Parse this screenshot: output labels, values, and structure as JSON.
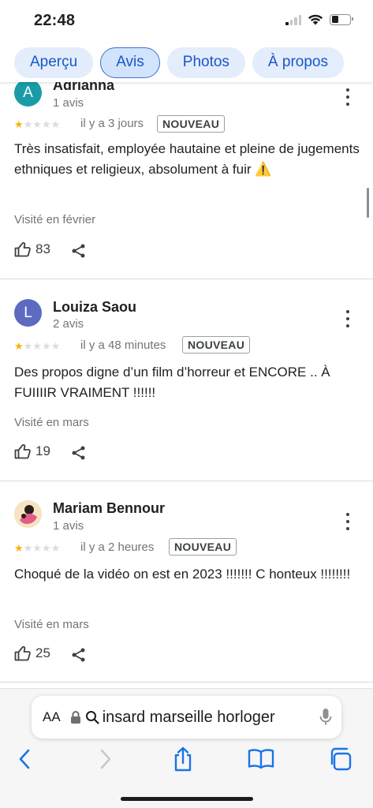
{
  "status_bar": {
    "time": "22:48"
  },
  "tabs": [
    {
      "label": "Aperçu",
      "active": false
    },
    {
      "label": "Avis",
      "active": true
    },
    {
      "label": "Photos",
      "active": false
    },
    {
      "label": "À propos",
      "active": false
    }
  ],
  "reviews": [
    {
      "avatar_letter": "A",
      "avatar_color": "#1a9ba8",
      "author": "Adrianna",
      "review_count": "1 avis",
      "rating": 1,
      "time": "il y a 3 jours",
      "badge": "NOUVEAU",
      "text": "Très insatisfait, employée hautaine et pleine de jugements ethniques et religieux, absolument à fuir ⚠️",
      "visited": "Visité en février",
      "likes": "83"
    },
    {
      "avatar_letter": "L",
      "avatar_color": "#5c6bc0",
      "author": "Louiza Saou",
      "review_count": "2 avis",
      "rating": 1,
      "time": "il y a 48 minutes",
      "badge": "NOUVEAU",
      "text": "Des propos digne d’un film d’horreur et ENCORE .. À FUIIIIR VRAIMENT !!!!!!",
      "visited": "Visité en mars",
      "likes": "19"
    },
    {
      "avatar_letter": "",
      "avatar_color": "#f3d9a8",
      "author": "Mariam Bennour",
      "review_count": "1 avis",
      "rating": 1,
      "time": "il y a 2 heures",
      "badge": "NOUVEAU",
      "text": "Choqué de la vidéo on est en 2023 !!!!!!! C honteux !!!!!!!!",
      "visited": "Visité en mars",
      "likes": "25"
    }
  ],
  "browser": {
    "aa_label": "AA",
    "url": "insard marseille horloger"
  },
  "colors": {
    "accent": "#1a56c9",
    "star": "#f5b400"
  }
}
